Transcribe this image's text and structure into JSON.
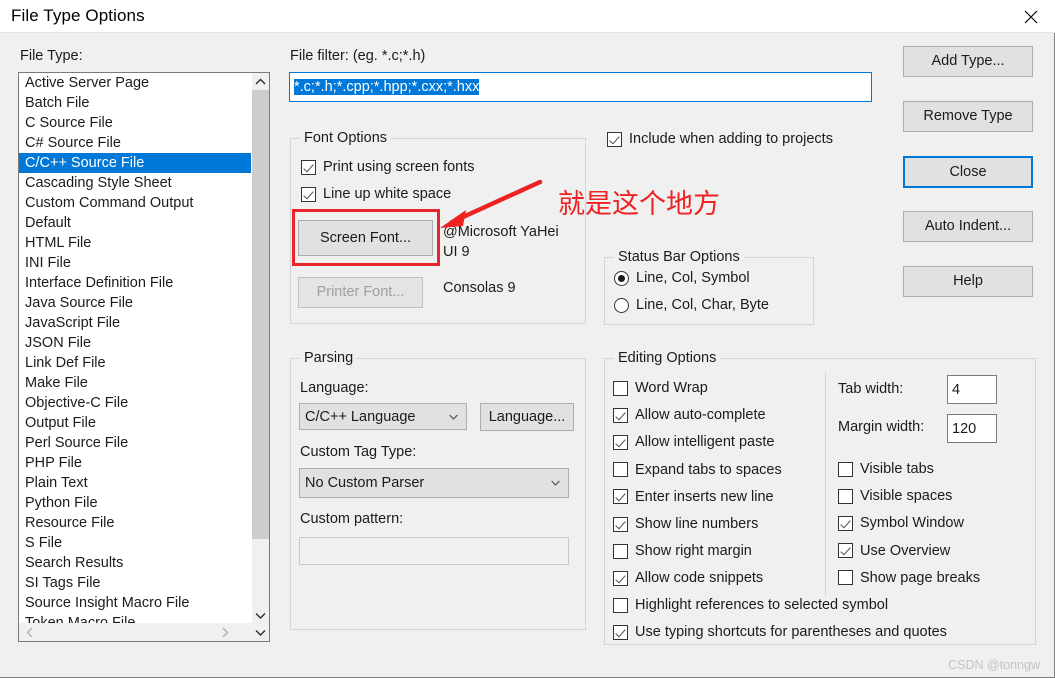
{
  "window": {
    "title": "File Type Options",
    "close_icon": "close-icon"
  },
  "file_type": {
    "label": "File Type:",
    "selected": "C/C++ Source File",
    "items": [
      "Active Server Page",
      "Batch File",
      "C Source File",
      "C# Source File",
      "C/C++ Source File",
      "Cascading Style Sheet",
      "Custom Command Output",
      "Default",
      "HTML File",
      "INI File",
      "Interface Definition File",
      "Java Source File",
      "JavaScript File",
      "JSON File",
      "Link Def File",
      "Make File",
      "Objective-C File",
      "Output File",
      "Perl Source File",
      "PHP File",
      "Plain Text",
      "Python File",
      "Resource File",
      "S File",
      "Search Results",
      "SI Tags File",
      "Source Insight Macro File",
      "Token Macro File"
    ]
  },
  "file_filter": {
    "label": "File filter: (eg. *.c;*.h)",
    "value": "*.c;*.h;*.cpp;*.hpp;*.cxx;*.hxx",
    "selected": true
  },
  "include_projects": {
    "label": "Include when adding to projects",
    "checked": true
  },
  "font_options": {
    "title": "Font Options",
    "print_using_screen_fonts": {
      "label": "Print using screen fonts",
      "checked": true
    },
    "line_up_white_space": {
      "label": "Line up white space",
      "checked": true
    },
    "screen_font_button": "Screen Font...",
    "screen_font_value": "@Microsoft YaHei UI 9",
    "printer_font_button": "Printer Font...",
    "printer_font_value": "Consolas 9",
    "printer_font_disabled": true
  },
  "status_bar_options": {
    "title": "Status Bar Options",
    "options": [
      {
        "label": "Line, Col, Symbol",
        "selected": true
      },
      {
        "label": "Line, Col, Char, Byte",
        "selected": false
      }
    ]
  },
  "parsing": {
    "title": "Parsing",
    "language_label": "Language:",
    "language_value": "C/C++ Language",
    "language_button": "Language...",
    "custom_tag_label": "Custom Tag Type:",
    "custom_tag_value": "No Custom Parser",
    "custom_pattern_label": "Custom pattern:",
    "custom_pattern_value": ""
  },
  "editing_options": {
    "title": "Editing Options",
    "left_column": [
      {
        "label": "Word Wrap",
        "checked": false
      },
      {
        "label": "Allow auto-complete",
        "checked": true
      },
      {
        "label": "Allow intelligent paste",
        "checked": true
      },
      {
        "label": "Expand tabs to spaces",
        "checked": false
      },
      {
        "label": "Enter inserts new line",
        "checked": true
      },
      {
        "label": "Show line numbers",
        "checked": true
      },
      {
        "label": "Show right margin",
        "checked": false
      },
      {
        "label": "Allow code snippets",
        "checked": true
      }
    ],
    "right_column": [
      {
        "label": "Visible tabs",
        "checked": false
      },
      {
        "label": "Visible spaces",
        "checked": false
      },
      {
        "label": "Symbol Window",
        "checked": true
      },
      {
        "label": "Use Overview",
        "checked": true
      },
      {
        "label": "Show page breaks",
        "checked": false
      }
    ],
    "bottom_rows": [
      {
        "label": "Highlight references to selected symbol",
        "checked": false
      },
      {
        "label": "Use typing shortcuts for parentheses and quotes",
        "checked": true
      }
    ],
    "tab_width_label": "Tab width:",
    "tab_width_value": "4",
    "margin_width_label": "Margin width:",
    "margin_width_value": "120"
  },
  "buttons": {
    "add_type": "Add Type...",
    "remove_type": "Remove Type",
    "close": "Close",
    "auto_indent": "Auto Indent...",
    "help": "Help"
  },
  "annotation": {
    "text": "就是这个地方",
    "color": "#ee2222"
  },
  "watermark": "CSDN @tonngw",
  "colors": {
    "accent": "#0078d7",
    "dialog_bg": "#f0f0f0",
    "annotation_red": "#e8262c"
  }
}
